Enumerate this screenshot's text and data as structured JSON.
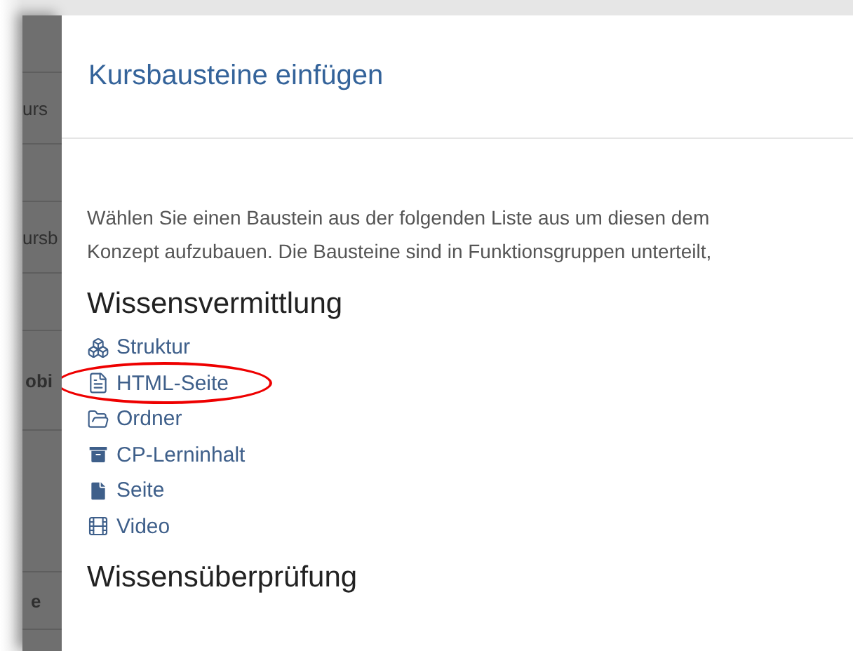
{
  "background_page": {
    "fragments": [
      {
        "text": "urs",
        "bold": false
      },
      {
        "text": "ursb",
        "bold": false
      },
      {
        "text": "obi",
        "bold": true
      },
      {
        "text": "e",
        "bold": true
      }
    ]
  },
  "dialog": {
    "title": "Kursbausteine einfügen",
    "intro_lines": [
      "Wählen Sie einen Baustein aus der folgenden Liste aus um diesen dem",
      "Konzept aufzubauen. Die Bausteine sind in Funktionsgruppen unterteilt,"
    ],
    "groups": [
      {
        "heading": "Wissensvermittlung",
        "items": [
          {
            "label": "Struktur",
            "kind": "structure",
            "highlighted": false
          },
          {
            "label": "HTML-Seite",
            "kind": "html",
            "highlighted": true
          },
          {
            "label": "Ordner",
            "kind": "folder",
            "highlighted": false
          },
          {
            "label": "CP-Lerninhalt",
            "kind": "cp",
            "highlighted": false
          },
          {
            "label": "Seite",
            "kind": "page",
            "highlighted": false
          },
          {
            "label": "Video",
            "kind": "video",
            "highlighted": false
          }
        ]
      },
      {
        "heading": "Wissensüberprüfung"
      }
    ]
  }
}
